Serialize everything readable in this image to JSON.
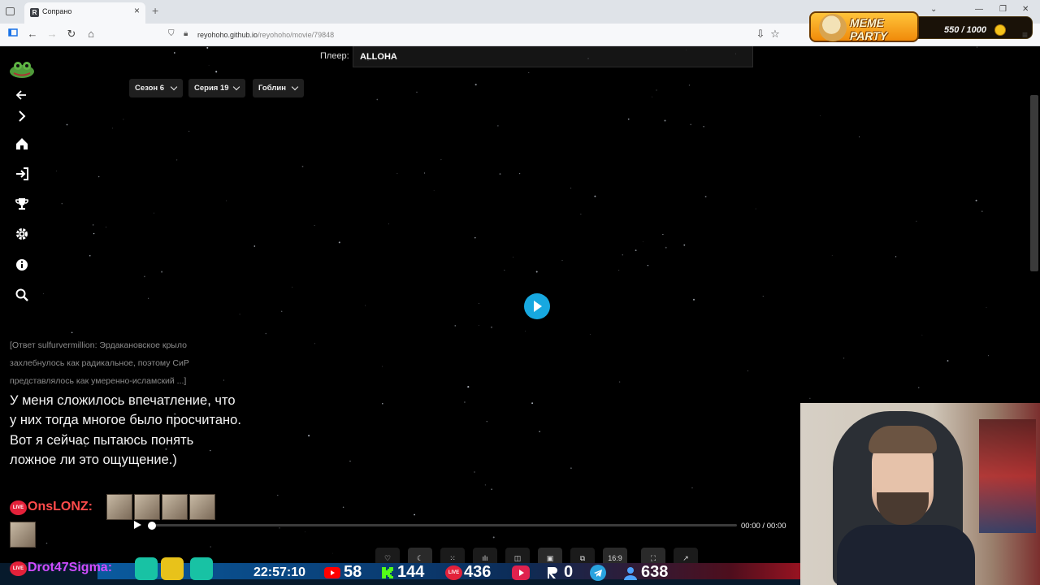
{
  "browser": {
    "tab_title": "Сопрано",
    "tab_favicon": "R",
    "url_host": "reyohoho.github.io",
    "url_path": "/reyohoho/movie/79848"
  },
  "overlay": {
    "meme_title": "MEME PARTY",
    "meme_count": "550 / 1000"
  },
  "sidebar": {
    "icons": [
      "frog-logo",
      "back-arrow-icon",
      "chevron-right-icon",
      "home-icon",
      "login-icon",
      "trophy-icon",
      "gear-icon",
      "info-icon",
      "search-icon"
    ]
  },
  "player": {
    "label": "Плеер:",
    "selected": "ALLOHA",
    "season": "Сезон 6",
    "episode": "Серия 19",
    "voice": "Гоблин",
    "time_current": "00:00",
    "time_sep": "/",
    "time_total": "00:00",
    "aspect": "16:9",
    "progress": 0
  },
  "chat": {
    "old_lines": [
      "[Ответ sulfurvermillion: Эрдакановское крыло",
      "захлебнулось как радикальное, поэтому СиР",
      "представлялось как умеренно-исламский ...]"
    ],
    "message": "У меня сложилось впечатление, что у них тогда многое было просчитано. Вот я сейчас пытаюсь понять ложное ли это ощущение.)",
    "user1": "OnsLONZ:",
    "user2": "Drot47Sigma:",
    "live_label": "LIVE"
  },
  "stream_stats": {
    "clock": "22:57:10",
    "youtube": "58",
    "kick": "144",
    "vklive": "436",
    "rutube": "0",
    "telegram_dummy": "",
    "viewers": "638"
  },
  "colors": {
    "accent": "#17a8e0",
    "live": "#e3213a",
    "chat_user1": "#ff4b4b",
    "chat_user2": "#d14cff"
  }
}
